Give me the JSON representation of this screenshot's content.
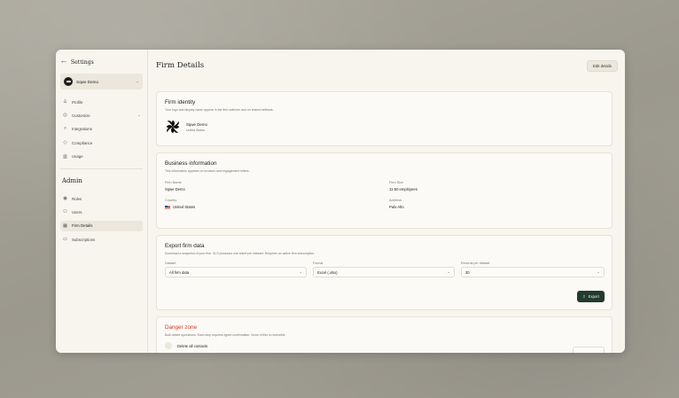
{
  "sidebar": {
    "back_label": "Settings",
    "firm_switcher": {
      "name": "Sqwe Demo"
    },
    "items": [
      {
        "label": "Profile",
        "icon": "user-icon"
      },
      {
        "label": "Customize",
        "icon": "palette-icon"
      },
      {
        "label": "Integrations",
        "icon": "plug-icon"
      },
      {
        "label": "Compliance",
        "icon": "shield-icon"
      },
      {
        "label": "Usage",
        "icon": "chart-icon"
      }
    ],
    "admin_title": "Admin",
    "admin_items": [
      {
        "label": "Roles",
        "icon": "roles-icon"
      },
      {
        "label": "Users",
        "icon": "users-icon"
      },
      {
        "label": "Firm Details",
        "icon": "building-icon",
        "active": true
      },
      {
        "label": "Subscriptions",
        "icon": "card-icon"
      }
    ]
  },
  "header": {
    "title": "Firm Details",
    "edit_label": "Edit details"
  },
  "identity": {
    "title": "Firm identity",
    "description": "Your logo and display name appear in the firm switcher and on shared artifacts.",
    "firm_name": "Sqwe Demo",
    "firm_country": "United States"
  },
  "business": {
    "title": "Business information",
    "description": "This information appears on invoices and engagement letters.",
    "fields": {
      "firm_name_label": "Firm Name",
      "firm_name_value": "Sqwe Demo",
      "firm_size_label": "Firm Size",
      "firm_size_value": "11-50 employees",
      "country_label": "Country",
      "country_value": "United States",
      "address_label": "Address",
      "address_value": "Palo Alto"
    }
  },
  "export": {
    "title": "Export firm data",
    "description": "Download a snapshot of your firm. XLS produces one sheet per dataset. Requires an active firm subscription.",
    "dataset_label": "Dataset",
    "dataset_value": "All firm data",
    "format_label": "Format",
    "format_value": "Excel (.xlsx)",
    "records_label": "Records per dataset",
    "records_value": "30",
    "export_label": "Export"
  },
  "danger": {
    "title": "Danger zone",
    "description": "Bulk delete operations. Each step requires typed confirmation. None of this is reversible.",
    "first_item": "Delete all contacts"
  },
  "colors": {
    "accent_dark_green": "#233a30",
    "danger_red": "#d0392e",
    "background": "#f7f5ee"
  }
}
